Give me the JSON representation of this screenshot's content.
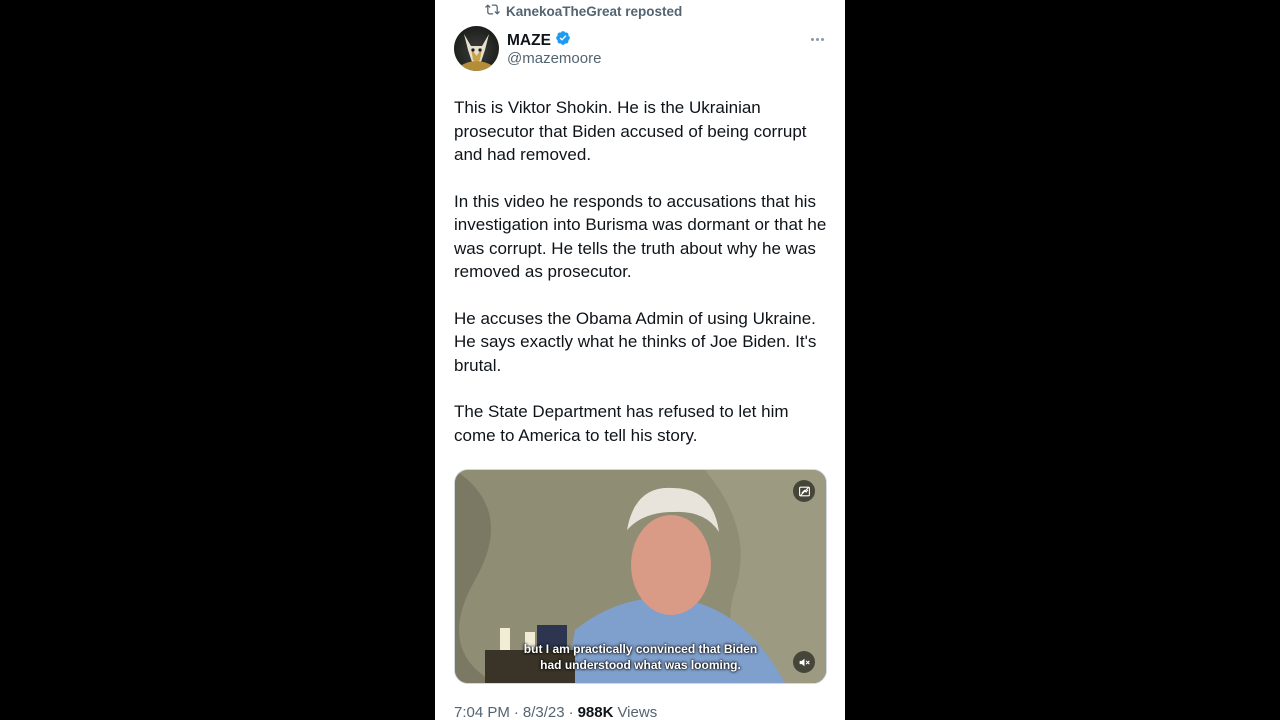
{
  "repost": {
    "label": "KanekoaTheGreat reposted",
    "icon": "repost-icon"
  },
  "author": {
    "name": "MAZE",
    "handle": "@mazemoore",
    "verified": true,
    "verified_color": "#1d9bf0"
  },
  "tweet": {
    "paragraphs": [
      "This is Viktor Shokin. He is the Ukrainian prosecutor that Biden accused of being corrupt and had removed.",
      "In this video he responds to accusations that his investigation into Burisma was dormant or that he was corrupt. He tells the truth about why he was removed as prosecutor.",
      "He accuses the Obama Admin of using Ukraine. He says exactly what he thinks of Joe Biden. It's brutal.",
      "The State Department has refused to let him come to America to tell his story."
    ]
  },
  "media": {
    "caption_line1": "but I am practically convinced that Biden",
    "caption_line2": "had understood what was looming.",
    "top_icon": "picture-in-picture-icon",
    "bottom_icon": "mute-icon"
  },
  "meta": {
    "time": "7:04 PM",
    "date": "8/3/23",
    "separator": "·",
    "views_count": "988K",
    "views_label": "Views"
  }
}
